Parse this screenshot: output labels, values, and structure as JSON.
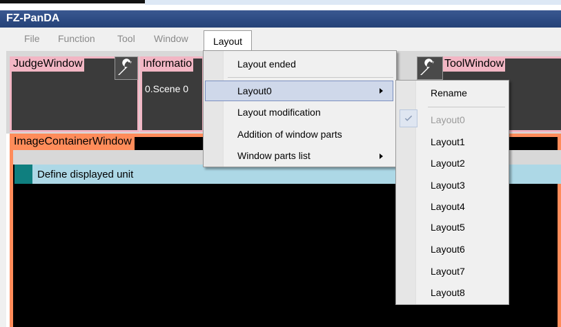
{
  "app": {
    "title": "FZ-PanDA"
  },
  "menubar": {
    "items": [
      "File",
      "Function",
      "Tool",
      "Window"
    ],
    "active": "Layout"
  },
  "panes": {
    "judge": "JudgeWindow",
    "information": "Informatio",
    "information_value": "0.Scene 0",
    "tool": "ToolWindow",
    "image_container": "ImageContainerWindow",
    "unit_label": "Define displayed unit"
  },
  "layout_menu": {
    "items": [
      {
        "label": "Layout ended"
      },
      {
        "label": "Layout0",
        "submenu": true,
        "highlighted": true
      },
      {
        "label": "Layout modification"
      },
      {
        "label": "Addition of window parts"
      },
      {
        "label": "Window parts list",
        "submenu": true
      }
    ]
  },
  "layout_submenu": {
    "rename": "Rename",
    "current": "Layout0",
    "items": [
      "Layout1",
      "Layout2",
      "Layout3",
      "Layout4",
      "Layout5",
      "Layout6",
      "Layout7",
      "Layout8"
    ]
  },
  "colors": {
    "title_bar": "#2c4a82",
    "pane_label": "#f2b6c4",
    "image_frame": "#ff8c5a",
    "unit_bar": "#add8e6",
    "unit_swatch": "#0f7f7f",
    "menu_highlight": "#cfd8ea"
  },
  "icons": [
    "wrench-icon",
    "check-icon",
    "submenu-arrow-icon"
  ]
}
